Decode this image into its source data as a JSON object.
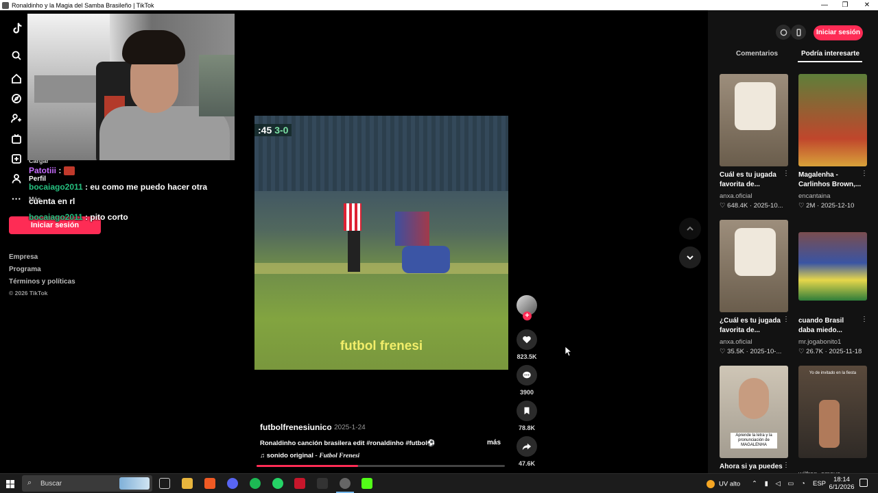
{
  "window": {
    "title": "Ronaldinho y la Magia del Samba Brasileño | TikTok",
    "min": "—",
    "max": "❐",
    "close": "✕"
  },
  "sidebar": {
    "login_label": "Iniciar sesión",
    "search_stub": "B",
    "footer": [
      "Empresa",
      "Programa",
      "Términos y políticas",
      "© 2026 TikTok"
    ],
    "partial_labels": {
      "cargar": "Cargar",
      "perfil": "Perfil",
      "mas": "Más"
    }
  },
  "chat": {
    "messages": [
      {
        "user": "Patotiii",
        "text": " : ",
        "user_color": "#c86dff"
      },
      {
        "user": "bocaiago2011",
        "text": " : eu como me puedo hacer otra",
        "user_color": "#26c281"
      },
      {
        "user": "",
        "text": "cuenta en rl",
        "user_color": "#26c281"
      },
      {
        "user": "bocaiago2011",
        "text": " : pito corto",
        "user_color": "#26c281"
      }
    ]
  },
  "video": {
    "scoreboard_time": ":45",
    "scoreboard_score": "3-0",
    "watermark": "futbol frenesi",
    "author": "futbolfrenesiunico",
    "date": "· 2025-1-24",
    "description": "Ronaldinho canción brasilera edit #ronaldinho #futbol⚽",
    "more": "más",
    "sound_label": "sonido original",
    "sound_author": "Futbol Frenesi",
    "progress": 0.41
  },
  "actions": {
    "likes": "823.5K",
    "comments": "3900",
    "saves": "78.8K",
    "shares": "47.6K"
  },
  "rightpanel": {
    "login_label": "Iniciar sesión",
    "tabs": [
      "Comentarios",
      "Podría interesarte"
    ],
    "videos": [
      {
        "title": "Cuál es tu jugada favorita de...",
        "author": "anxa.oficial",
        "likes": "648.4K",
        "date": "2025-10..."
      },
      {
        "title": "Magalenha - Carlinhos Brown,...",
        "author": "encantaina",
        "likes": "2M",
        "date": "2025-12-10"
      },
      {
        "title": "¿Cuál es tu jugada favorita de...",
        "author": "anxa.oficial",
        "likes": "35.5K",
        "date": "2025-10-..."
      },
      {
        "title": "cuando Brasil daba miedo...",
        "author": "mr.jogabonito1",
        "likes": "26.7K",
        "date": "2025-11-18"
      },
      {
        "title": "Ahora si ya puedes",
        "author": "",
        "likes": "",
        "date": ""
      },
      {
        "title": "",
        "author": "wilfren_amaya",
        "likes": "",
        "date": ""
      }
    ],
    "thumb_caption": "Aprende la letra y la pronunciación de MAGALENHA",
    "thumb_text_top": "Yo de invitado en la fiesta"
  },
  "taskbar": {
    "search_placeholder": "Buscar",
    "weather": "UV alto",
    "language": "ESP",
    "time": "18:14",
    "date": "6/1/2026"
  },
  "colors": {
    "accent": "#fe2c55",
    "background": "#000000",
    "panel": "#121212"
  }
}
